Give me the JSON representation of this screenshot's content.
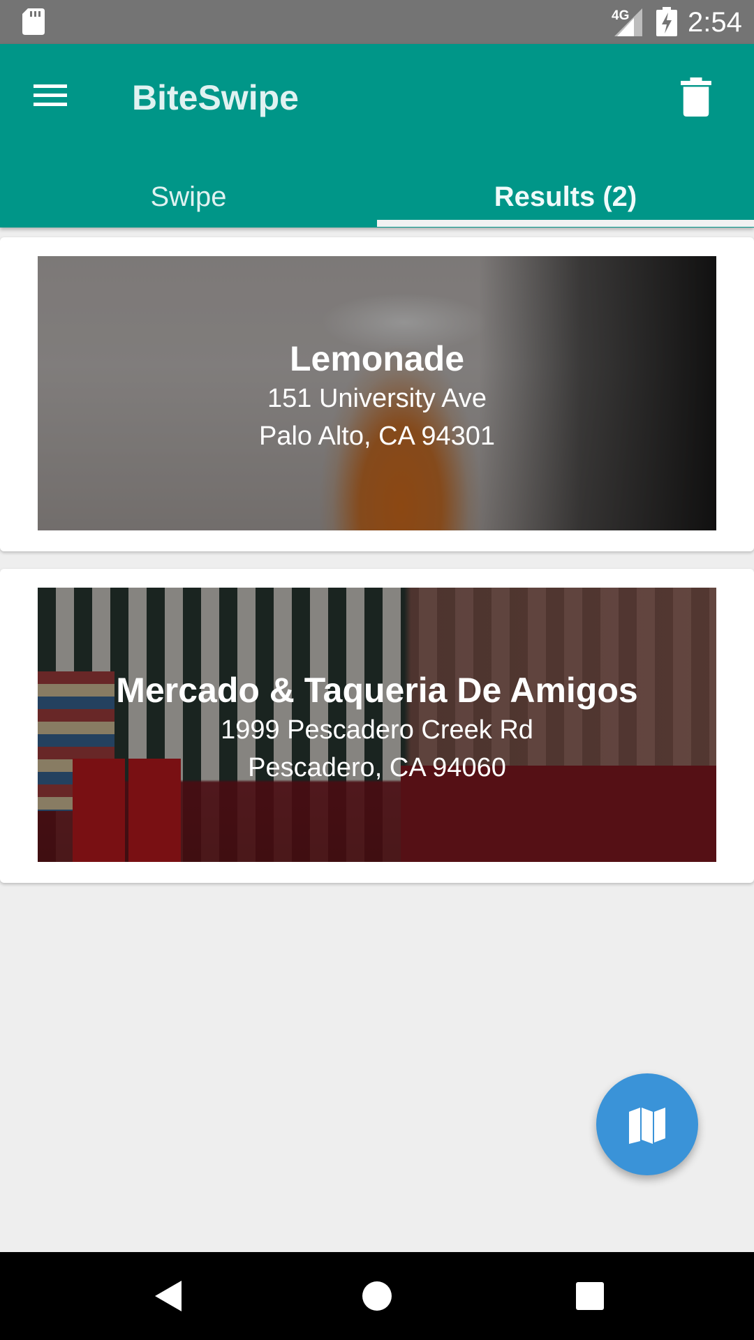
{
  "status_bar": {
    "time": "2:54",
    "network": "4G",
    "icons": [
      "sd-card-icon",
      "signal-icon",
      "battery-charging-icon"
    ]
  },
  "app_bar": {
    "title": "BiteSwipe",
    "menu_icon": "hamburger-menu-icon",
    "delete_icon": "trash-icon",
    "background_color": "#009688"
  },
  "tabs": [
    {
      "label": "Swipe",
      "selected": false
    },
    {
      "label": "Results (2)",
      "selected": true
    }
  ],
  "results": [
    {
      "name": "Lemonade",
      "address_line1": "151 University Ave",
      "address_line2": "Palo Alto, CA 94301"
    },
    {
      "name": "Mercado & Taqueria De Amigos",
      "address_line1": "1999 Pescadero Creek Rd",
      "address_line2": "Pescadero, CA 94060"
    }
  ],
  "fab": {
    "icon": "map-icon",
    "color": "#3a93d8"
  },
  "nav_bar": {
    "icons": [
      "back-icon",
      "home-icon",
      "recents-icon"
    ]
  }
}
